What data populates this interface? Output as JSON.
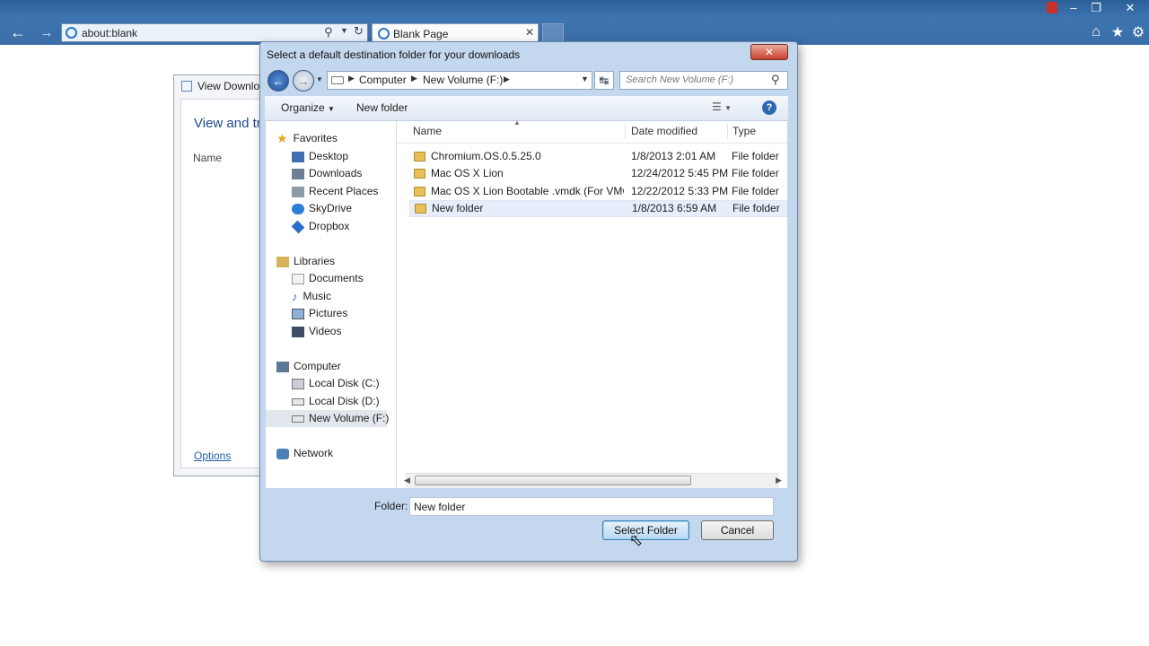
{
  "browser": {
    "address": "about:blank",
    "tab_title": "Blank Page"
  },
  "downloads_window": {
    "title": "View Downloads - Windows Internet Explorer",
    "heading": "View and tra",
    "name_col": "Name",
    "options_link": "Options"
  },
  "dialog": {
    "title": "Select a default destination folder for your downloads",
    "close_label": "✕",
    "breadcrumb": [
      "Computer",
      "New Volume (F:)"
    ],
    "search_placeholder": "Search New Volume (F:)",
    "toolbar": {
      "organize": "Organize",
      "new_folder": "New folder"
    },
    "columns": {
      "name": "Name",
      "date": "Date modified",
      "type": "Type"
    },
    "files": [
      {
        "name": "Chromium.OS.0.5.25.0",
        "date": "1/8/2013 2:01 AM",
        "type": "File folder"
      },
      {
        "name": "Mac OS X Lion",
        "date": "12/24/2012 5:45 PM",
        "type": "File folder"
      },
      {
        "name": "Mac OS X Lion Bootable .vmdk (For VMw...",
        "date": "12/22/2012 5:33 PM",
        "type": "File folder"
      },
      {
        "name": "New folder",
        "date": "1/8/2013 6:59 AM",
        "type": "File folder"
      }
    ],
    "nav": {
      "favorites": {
        "label": "Favorites",
        "items": [
          "Desktop",
          "Downloads",
          "Recent Places",
          "SkyDrive",
          "Dropbox"
        ]
      },
      "libraries": {
        "label": "Libraries",
        "items": [
          "Documents",
          "Music",
          "Pictures",
          "Videos"
        ]
      },
      "computer": {
        "label": "Computer",
        "items": [
          "Local Disk (C:)",
          "Local Disk (D:)",
          "New Volume (F:)"
        ]
      },
      "network": {
        "label": "Network"
      }
    },
    "folder_label": "Folder:",
    "folder_value": "New folder",
    "select_button": "Select Folder",
    "cancel_button": "Cancel"
  },
  "colors": {
    "titlebar": "#3a6ea8",
    "dialog_frame": "#c3d7ee",
    "selection": "#e5eefa"
  }
}
